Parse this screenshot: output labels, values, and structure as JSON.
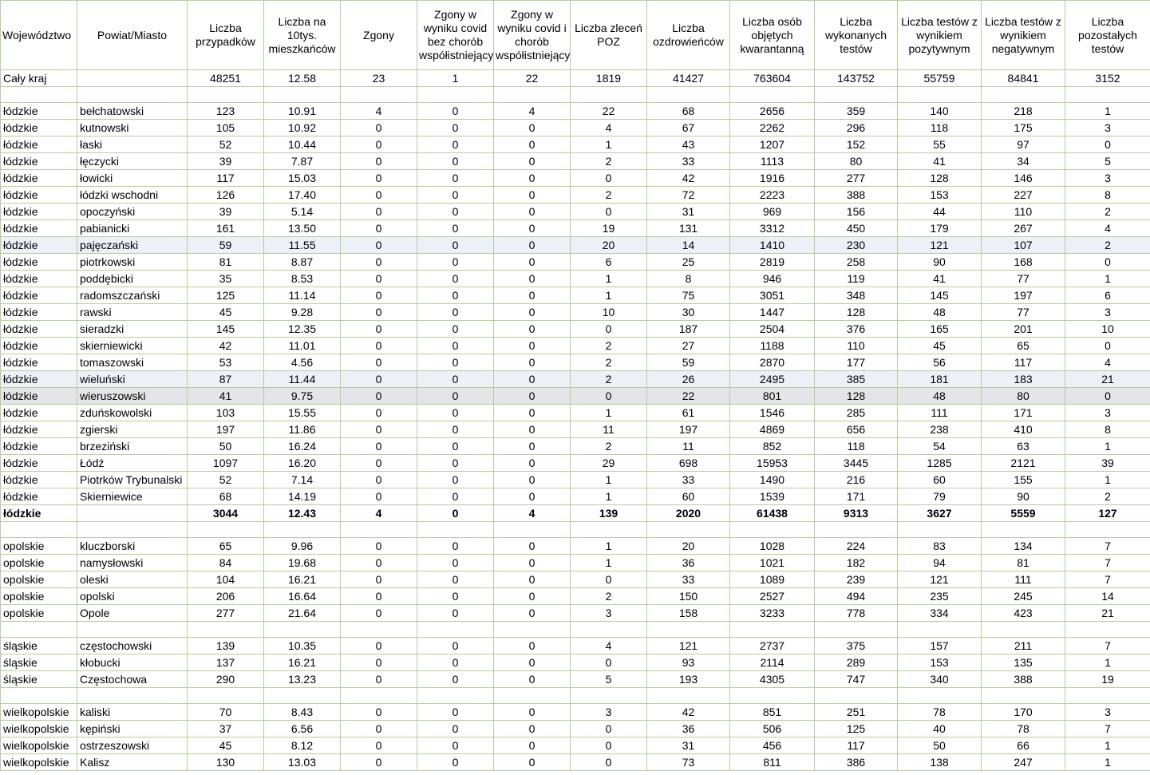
{
  "columns": [
    "Województwo",
    "Powiat/Miasto",
    "Liczba przypadków",
    "Liczba na 10tys. mieszkańców",
    "Zgony",
    "Zgony w wyniku covid bez chorób współistniejących",
    "Zgony w wyniku covid i chorób współistniejących",
    "Liczba zleceń POZ",
    "Liczba ozdrowieńców",
    "Liczba osób objętych kwarantanną",
    "Liczba wykonanych testów",
    "Liczba testów z wynikiem pozytywnym",
    "Liczba testów z wynikiem negatywnym",
    "Liczba pozostałych testów"
  ],
  "rows": [
    {
      "type": "data",
      "cells": [
        "Cały kraj",
        "",
        "48251",
        "12.58",
        "23",
        "1",
        "22",
        "1819",
        "41427",
        "763604",
        "143752",
        "55759",
        "84841",
        "3152"
      ]
    },
    {
      "type": "spacer"
    },
    {
      "type": "data",
      "cells": [
        "łódzkie",
        "bełchatowski",
        "123",
        "10.91",
        "4",
        "0",
        "4",
        "22",
        "68",
        "2656",
        "359",
        "140",
        "218",
        "1"
      ]
    },
    {
      "type": "data",
      "cells": [
        "łódzkie",
        "kutnowski",
        "105",
        "10.92",
        "0",
        "0",
        "0",
        "4",
        "67",
        "2262",
        "296",
        "118",
        "175",
        "3"
      ]
    },
    {
      "type": "data",
      "cells": [
        "łódzkie",
        "łaski",
        "52",
        "10.44",
        "0",
        "0",
        "0",
        "1",
        "43",
        "1207",
        "152",
        "55",
        "97",
        "0"
      ]
    },
    {
      "type": "data",
      "cells": [
        "łódzkie",
        "łęczycki",
        "39",
        "7.87",
        "0",
        "0",
        "0",
        "2",
        "33",
        "1113",
        "80",
        "41",
        "34",
        "5"
      ]
    },
    {
      "type": "data",
      "cells": [
        "łódzkie",
        "łowicki",
        "117",
        "15.03",
        "0",
        "0",
        "0",
        "0",
        "42",
        "1916",
        "277",
        "128",
        "146",
        "3"
      ]
    },
    {
      "type": "data",
      "cells": [
        "łódzkie",
        "łódzki wschodni",
        "126",
        "17.40",
        "0",
        "0",
        "0",
        "2",
        "72",
        "2223",
        "388",
        "153",
        "227",
        "8"
      ]
    },
    {
      "type": "data",
      "cells": [
        "łódzkie",
        "opoczyński",
        "39",
        "5.14",
        "0",
        "0",
        "0",
        "0",
        "31",
        "969",
        "156",
        "44",
        "110",
        "2"
      ]
    },
    {
      "type": "data",
      "cells": [
        "łódzkie",
        "pabianicki",
        "161",
        "13.50",
        "0",
        "0",
        "0",
        "19",
        "131",
        "3312",
        "450",
        "179",
        "267",
        "4"
      ]
    },
    {
      "type": "data",
      "hl": "blue",
      "cells": [
        "łódzkie",
        "pajęczański",
        "59",
        "11.55",
        "0",
        "0",
        "0",
        "20",
        "14",
        "1410",
        "230",
        "121",
        "107",
        "2"
      ]
    },
    {
      "type": "data",
      "cells": [
        "łódzkie",
        "piotrkowski",
        "81",
        "8.87",
        "0",
        "0",
        "0",
        "6",
        "25",
        "2819",
        "258",
        "90",
        "168",
        "0"
      ]
    },
    {
      "type": "data",
      "cells": [
        "łódzkie",
        "poddębicki",
        "35",
        "8.53",
        "0",
        "0",
        "0",
        "1",
        "8",
        "946",
        "119",
        "41",
        "77",
        "1"
      ]
    },
    {
      "type": "data",
      "cells": [
        "łódzkie",
        "radomszczański",
        "125",
        "11.14",
        "0",
        "0",
        "0",
        "1",
        "75",
        "3051",
        "348",
        "145",
        "197",
        "6"
      ]
    },
    {
      "type": "data",
      "cells": [
        "łódzkie",
        "rawski",
        "45",
        "9.28",
        "0",
        "0",
        "0",
        "10",
        "30",
        "1447",
        "128",
        "48",
        "77",
        "3"
      ]
    },
    {
      "type": "data",
      "cells": [
        "łódzkie",
        "sieradzki",
        "145",
        "12.35",
        "0",
        "0",
        "0",
        "0",
        "187",
        "2504",
        "376",
        "165",
        "201",
        "10"
      ]
    },
    {
      "type": "data",
      "cells": [
        "łódzkie",
        "skierniewicki",
        "42",
        "11.01",
        "0",
        "0",
        "0",
        "2",
        "27",
        "1188",
        "110",
        "45",
        "65",
        "0"
      ]
    },
    {
      "type": "data",
      "cells": [
        "łódzkie",
        "tomaszowski",
        "53",
        "4.56",
        "0",
        "0",
        "0",
        "2",
        "59",
        "2870",
        "177",
        "56",
        "117",
        "4"
      ]
    },
    {
      "type": "data",
      "hl": "blue",
      "cells": [
        "łódzkie",
        "wieluński",
        "87",
        "11.44",
        "0",
        "0",
        "0",
        "2",
        "26",
        "2495",
        "385",
        "181",
        "183",
        "21"
      ]
    },
    {
      "type": "data",
      "hl": "gray",
      "cells": [
        "łódzkie",
        "wieruszowski",
        "41",
        "9.75",
        "0",
        "0",
        "0",
        "0",
        "22",
        "801",
        "128",
        "48",
        "80",
        "0"
      ]
    },
    {
      "type": "data",
      "cells": [
        "łódzkie",
        "zduńskowolski",
        "103",
        "15.55",
        "0",
        "0",
        "0",
        "1",
        "61",
        "1546",
        "285",
        "111",
        "171",
        "3"
      ]
    },
    {
      "type": "data",
      "cells": [
        "łódzkie",
        "zgierski",
        "197",
        "11.86",
        "0",
        "0",
        "0",
        "11",
        "197",
        "4869",
        "656",
        "238",
        "410",
        "8"
      ]
    },
    {
      "type": "data",
      "cells": [
        "łódzkie",
        "brzeziński",
        "50",
        "16.24",
        "0",
        "0",
        "0",
        "2",
        "11",
        "852",
        "118",
        "54",
        "63",
        "1"
      ]
    },
    {
      "type": "data",
      "cells": [
        "łódzkie",
        "Łódź",
        "1097",
        "16.20",
        "0",
        "0",
        "0",
        "29",
        "698",
        "15953",
        "3445",
        "1285",
        "2121",
        "39"
      ]
    },
    {
      "type": "data",
      "cells": [
        "łódzkie",
        "Piotrków Trybunalski",
        "52",
        "7.14",
        "0",
        "0",
        "0",
        "1",
        "33",
        "1490",
        "216",
        "60",
        "155",
        "1"
      ]
    },
    {
      "type": "data",
      "cells": [
        "łódzkie",
        "Skierniewice",
        "68",
        "14.19",
        "0",
        "0",
        "0",
        "1",
        "60",
        "1539",
        "171",
        "79",
        "90",
        "2"
      ]
    },
    {
      "type": "sum",
      "cells": [
        "łódzkie",
        "",
        "3044",
        "12.43",
        "4",
        "0",
        "4",
        "139",
        "2020",
        "61438",
        "9313",
        "3627",
        "5559",
        "127"
      ]
    },
    {
      "type": "spacer"
    },
    {
      "type": "data",
      "cells": [
        "opolskie",
        "kluczborski",
        "65",
        "9.96",
        "0",
        "0",
        "0",
        "1",
        "20",
        "1028",
        "224",
        "83",
        "134",
        "7"
      ]
    },
    {
      "type": "data",
      "cells": [
        "opolskie",
        "namysłowski",
        "84",
        "19.68",
        "0",
        "0",
        "0",
        "1",
        "36",
        "1021",
        "182",
        "94",
        "81",
        "7"
      ]
    },
    {
      "type": "data",
      "cells": [
        "opolskie",
        "oleski",
        "104",
        "16.21",
        "0",
        "0",
        "0",
        "0",
        "33",
        "1089",
        "239",
        "121",
        "111",
        "7"
      ]
    },
    {
      "type": "data",
      "cells": [
        "opolskie",
        "opolski",
        "206",
        "16.64",
        "0",
        "0",
        "0",
        "2",
        "150",
        "2527",
        "494",
        "235",
        "245",
        "14"
      ]
    },
    {
      "type": "data",
      "cells": [
        "opolskie",
        "Opole",
        "277",
        "21.64",
        "0",
        "0",
        "0",
        "3",
        "158",
        "3233",
        "778",
        "334",
        "423",
        "21"
      ]
    },
    {
      "type": "spacer"
    },
    {
      "type": "data",
      "cells": [
        "śląskie",
        "częstochowski",
        "139",
        "10.35",
        "0",
        "0",
        "0",
        "4",
        "121",
        "2737",
        "375",
        "157",
        "211",
        "7"
      ]
    },
    {
      "type": "data",
      "cells": [
        "śląskie",
        "kłobucki",
        "137",
        "16.21",
        "0",
        "0",
        "0",
        "0",
        "93",
        "2114",
        "289",
        "153",
        "135",
        "1"
      ]
    },
    {
      "type": "data",
      "cells": [
        "śląskie",
        "Częstochowa",
        "290",
        "13.23",
        "0",
        "0",
        "0",
        "5",
        "193",
        "4305",
        "747",
        "340",
        "388",
        "19"
      ]
    },
    {
      "type": "spacer"
    },
    {
      "type": "data",
      "cells": [
        "wielkopolskie",
        "kaliski",
        "70",
        "8.43",
        "0",
        "0",
        "0",
        "3",
        "42",
        "851",
        "251",
        "78",
        "170",
        "3"
      ]
    },
    {
      "type": "data",
      "cells": [
        "wielkopolskie",
        "kępiński",
        "37",
        "6.56",
        "0",
        "0",
        "0",
        "0",
        "36",
        "506",
        "125",
        "40",
        "78",
        "7"
      ]
    },
    {
      "type": "data",
      "cells": [
        "wielkopolskie",
        "ostrzeszowski",
        "45",
        "8.12",
        "0",
        "0",
        "0",
        "0",
        "31",
        "456",
        "117",
        "50",
        "66",
        "1"
      ]
    },
    {
      "type": "data",
      "cells": [
        "wielkopolskie",
        "Kalisz",
        "130",
        "13.03",
        "0",
        "0",
        "0",
        "0",
        "73",
        "811",
        "386",
        "138",
        "247",
        "1"
      ]
    }
  ]
}
